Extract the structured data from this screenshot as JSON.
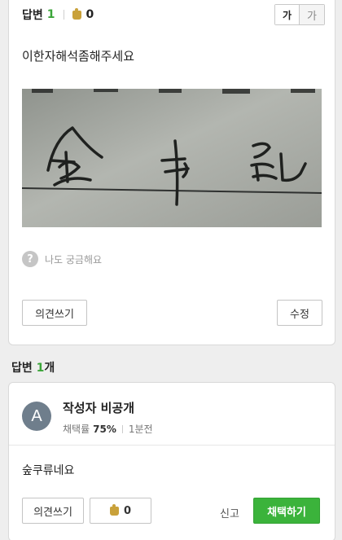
{
  "question": {
    "answers_label": "답변",
    "answers_count": "1",
    "likes": "0",
    "font_large": "가",
    "font_small": "가",
    "title": "이한자해석좀해주세요",
    "curious_icon": "?",
    "curious_label": "나도 궁금해요",
    "comment_button": "의견쓰기",
    "edit_button": "수정"
  },
  "answers_section": {
    "label": "답변",
    "count": "1",
    "suffix": "개"
  },
  "answer": {
    "avatar_letter": "A",
    "author": "작성자 비공개",
    "adoption_label": "채택률",
    "adoption_rate": "75%",
    "elapsed": "1분전",
    "text": "숲쿠류네요",
    "comment_button": "의견쓰기",
    "likes": "0",
    "report_link": "신고",
    "select_button": "채택하기"
  },
  "icons": [
    "thumbs-up-icon",
    "question-circle-icon"
  ],
  "colors": {
    "accent_green": "#3ba539",
    "select_button": "#3bb33b"
  }
}
